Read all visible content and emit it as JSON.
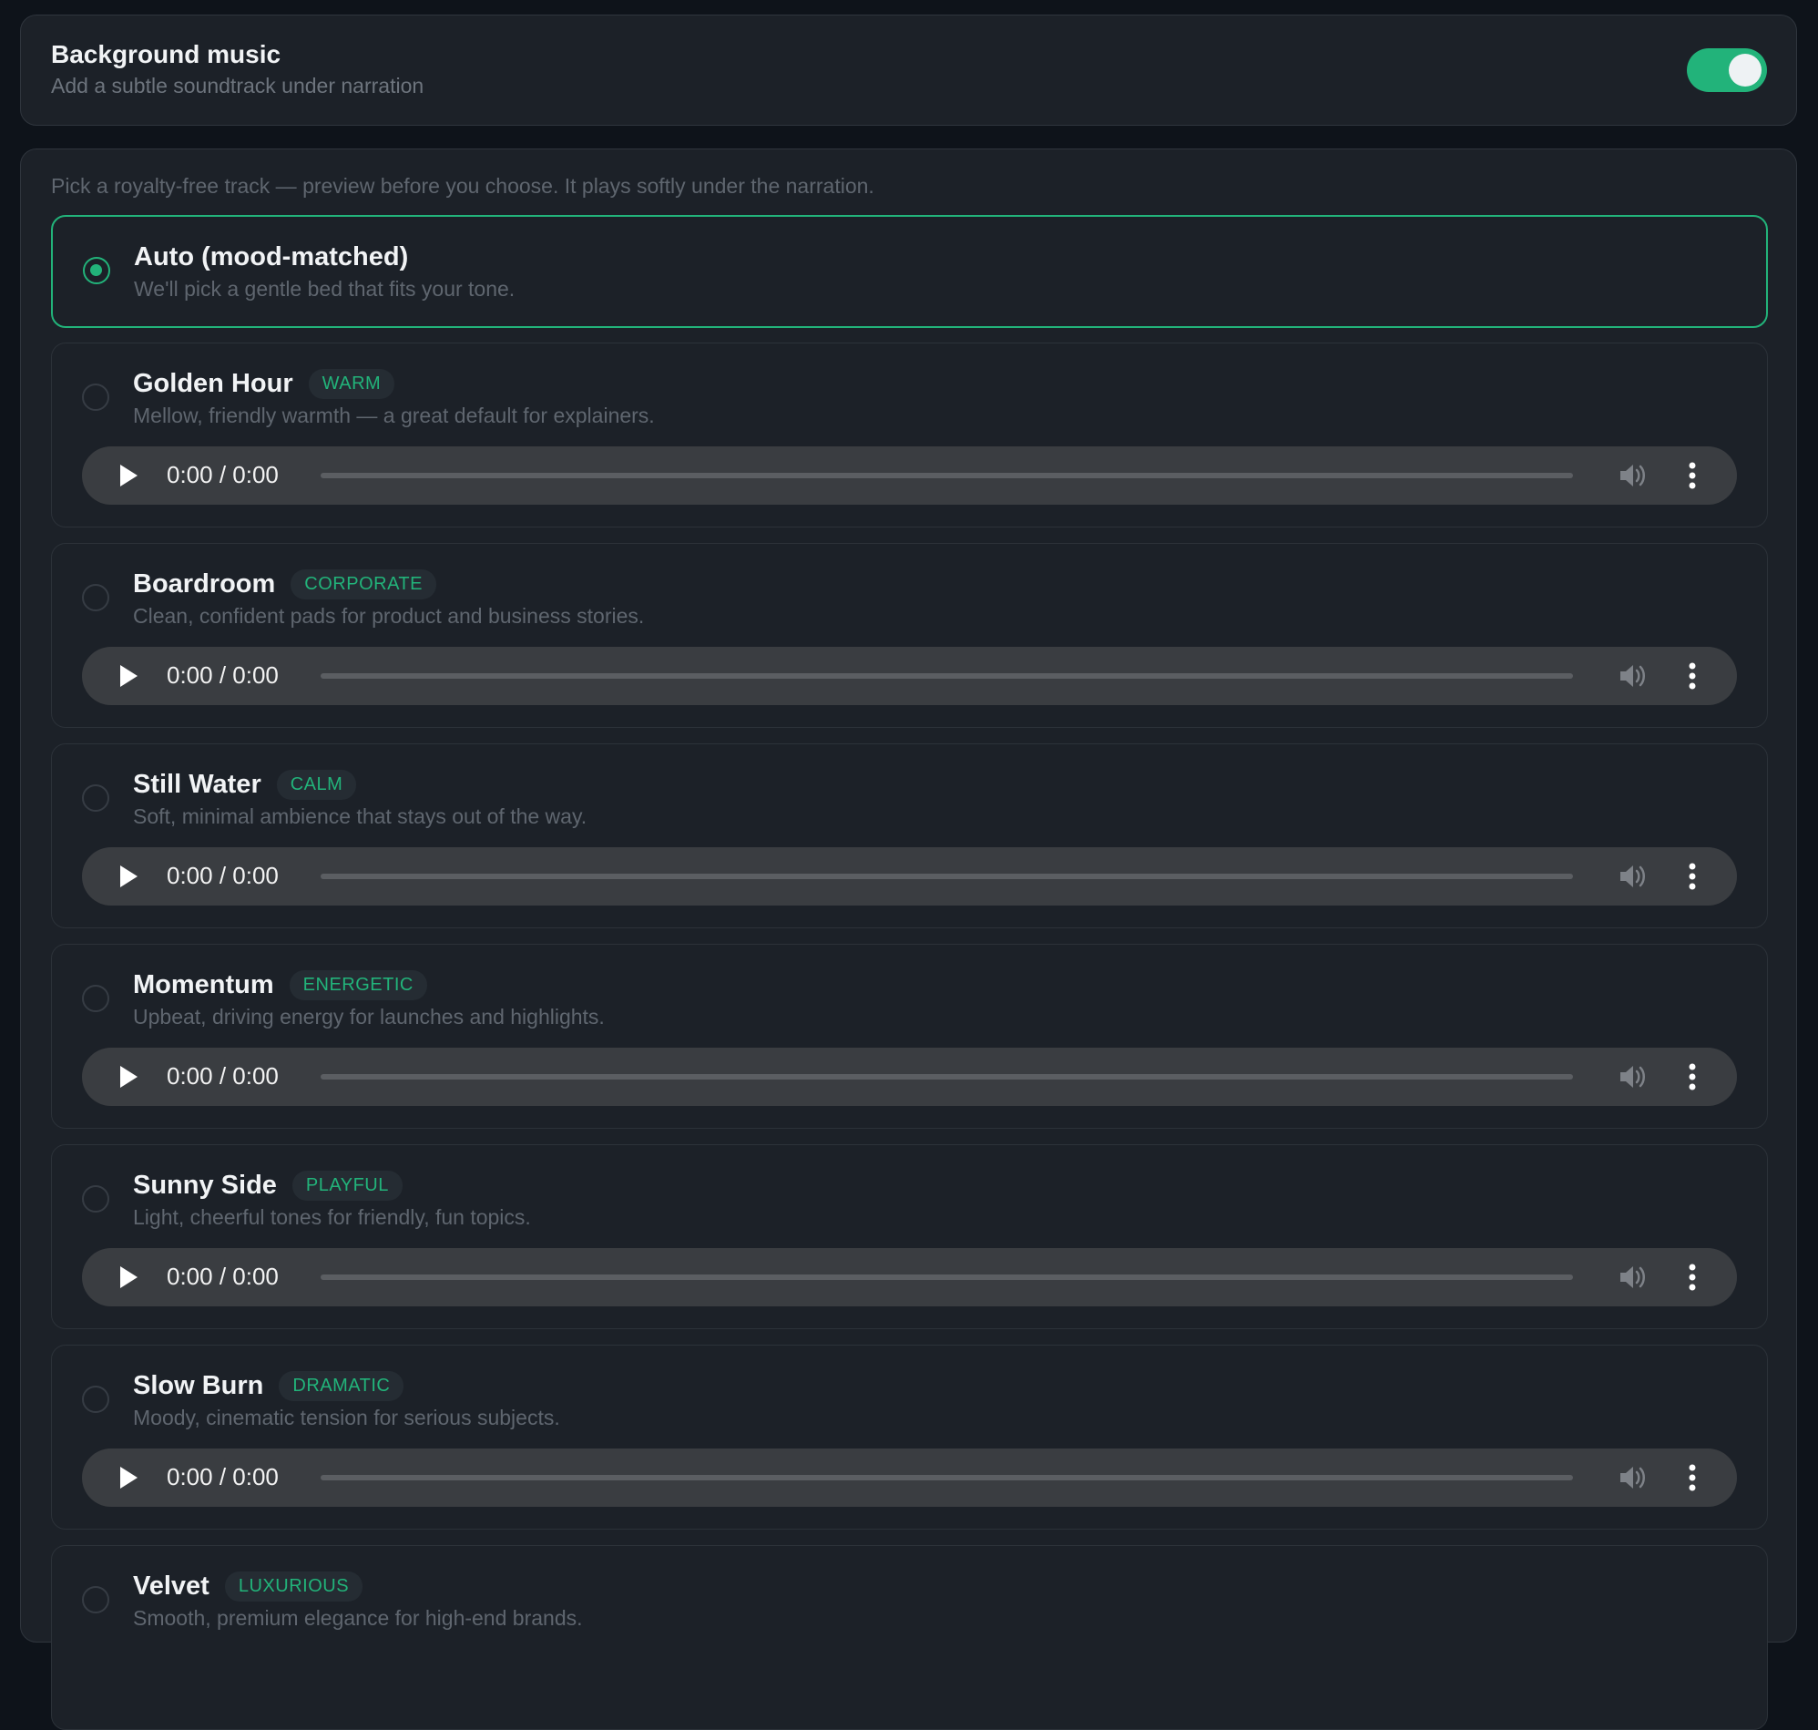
{
  "bg_music": {
    "title": "Background music",
    "subtitle": "Add a subtle soundtrack under narration",
    "enabled": true
  },
  "picker": {
    "hint": "Pick a royalty-free track — preview before you choose. It plays softly under the narration."
  },
  "auto_option": {
    "name": "Auto (mood-matched)",
    "description": "We'll pick a gentle bed that fits your tone.",
    "selected": true
  },
  "tracks": [
    {
      "name": "Golden Hour",
      "tag": "WARM",
      "description": "Mellow, friendly warmth — a great default for explainers.",
      "time": "0:00 / 0:00"
    },
    {
      "name": "Boardroom",
      "tag": "CORPORATE",
      "description": "Clean, confident pads for product and business stories.",
      "time": "0:00 / 0:00"
    },
    {
      "name": "Still Water",
      "tag": "CALM",
      "description": "Soft, minimal ambience that stays out of the way.",
      "time": "0:00 / 0:00"
    },
    {
      "name": "Momentum",
      "tag": "ENERGETIC",
      "description": "Upbeat, driving energy for launches and highlights.",
      "time": "0:00 / 0:00"
    },
    {
      "name": "Sunny Side",
      "tag": "PLAYFUL",
      "description": "Light, cheerful tones for friendly, fun topics.",
      "time": "0:00 / 0:00"
    },
    {
      "name": "Slow Burn",
      "tag": "DRAMATIC",
      "description": "Moody, cinematic tension for serious subjects.",
      "time": "0:00 / 0:00"
    },
    {
      "name": "Velvet",
      "tag": "LUXURIOUS",
      "description": "Smooth, premium elegance for high-end brands."
    }
  ],
  "colors": {
    "accent": "#22b37a",
    "background": "#0e131a",
    "card": "#1c2128",
    "player": "#3a3d41"
  },
  "icons": {
    "play": "play-icon",
    "volume": "volume-icon",
    "more": "more-vertical-icon"
  }
}
